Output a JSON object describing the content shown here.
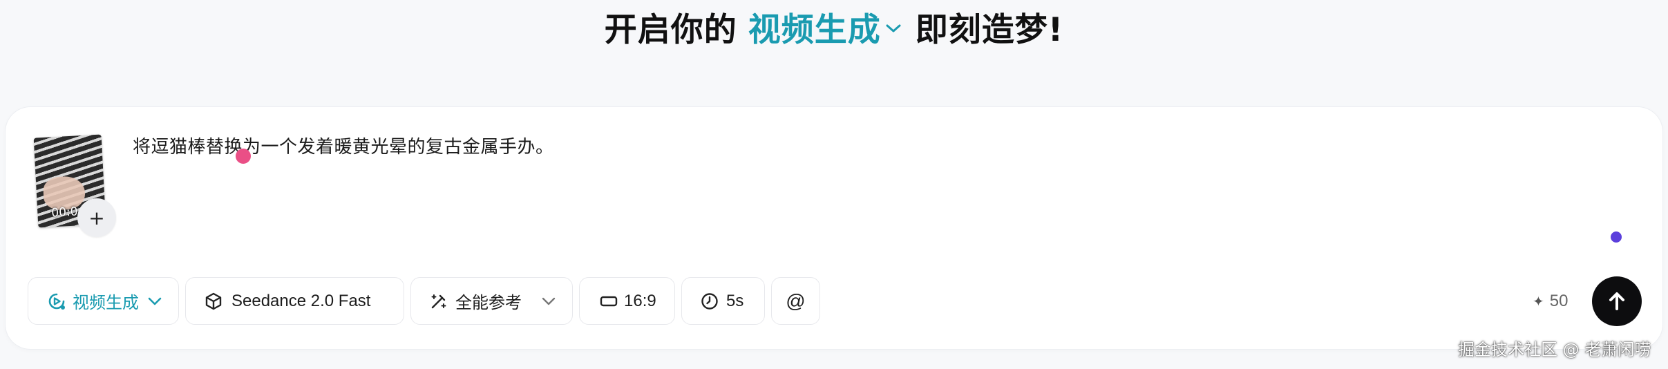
{
  "headline": {
    "prefix": "开启你的",
    "mode": "视频生成",
    "suffix": "即刻造梦!"
  },
  "composer": {
    "prompt_text": "将逗猫棒替换为一个发着暖黄光晕的复古金属手办。",
    "thumbnail_time": "00:0",
    "add_label": "+"
  },
  "toolbar": {
    "mode": "视频生成",
    "model": "Seedance 2.0 Fast",
    "reference": "全能参考",
    "ratio": "16:9",
    "duration": "5s",
    "mention": "@"
  },
  "credits": {
    "spark_icon": "✦",
    "value": "50"
  },
  "watermark": "掘金技术社区 @ 老萧闲唠",
  "colors": {
    "accent": "#1a9bb0",
    "send_button": "#0d0d0f",
    "pink_dot": "#ea4f86",
    "purple_dot": "#5b3fdc"
  },
  "icons": {
    "mode": "video-play-icon",
    "model": "cube-icon",
    "reference": "magic-wand-icon",
    "ratio": "aspect-ratio-icon",
    "duration": "clock-icon",
    "send": "arrow-up-icon"
  }
}
